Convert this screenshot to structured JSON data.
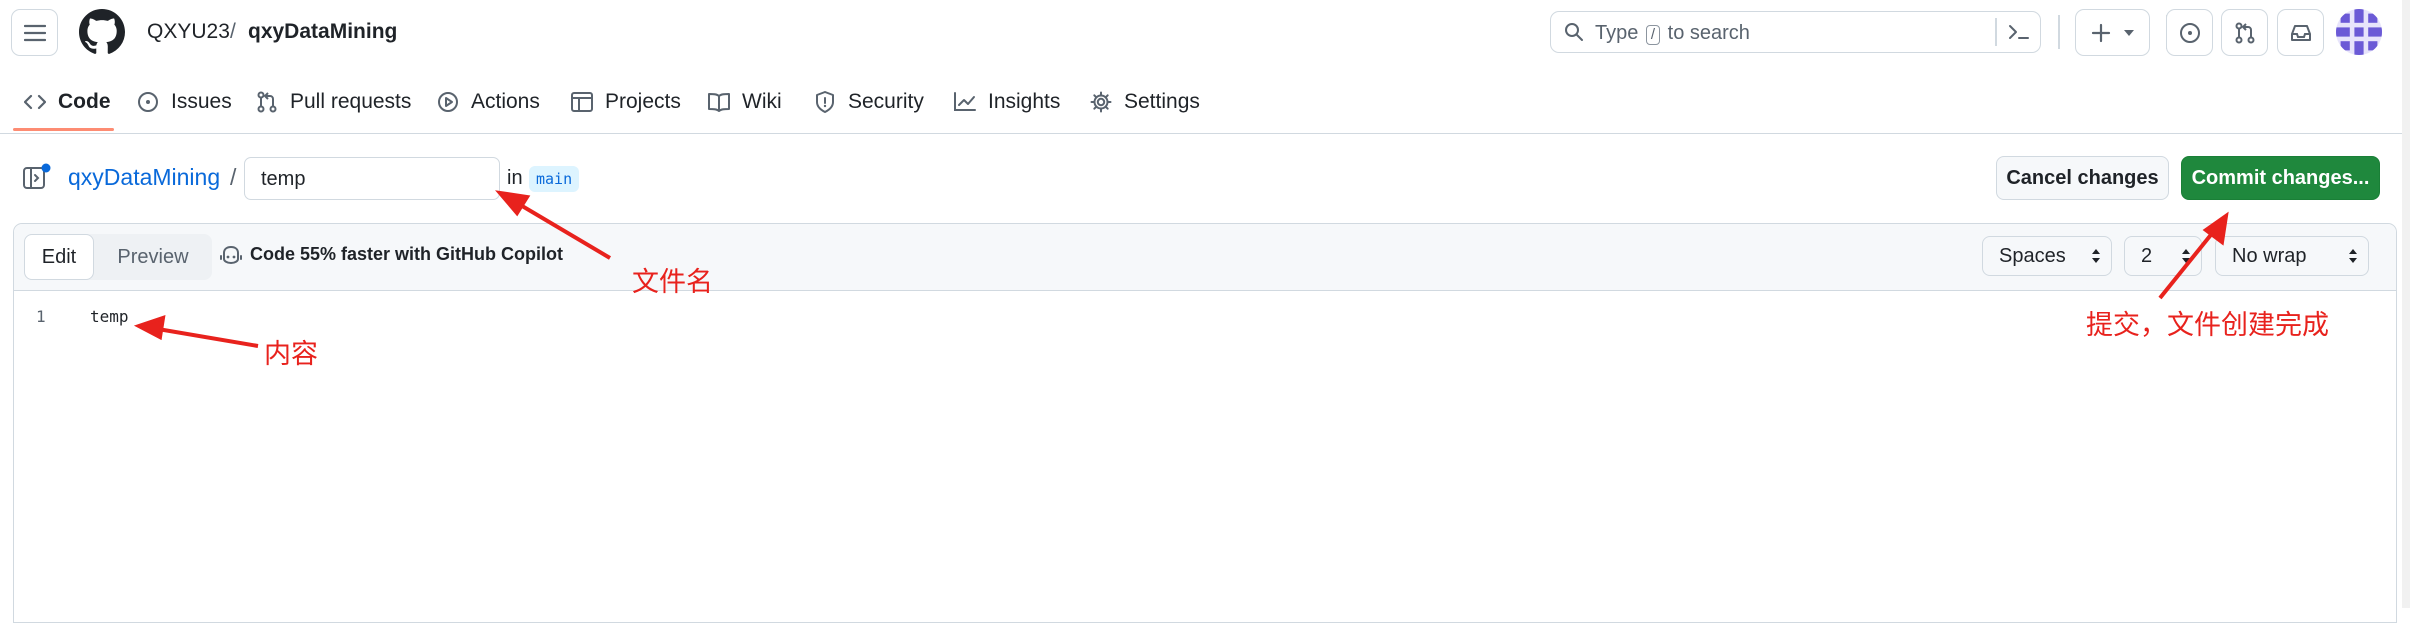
{
  "header": {
    "owner": "QXYU23",
    "separator": "/",
    "repo": "qxyDataMining",
    "search": {
      "prefix": "Type",
      "key": "/",
      "suffix": "to search"
    }
  },
  "tabs": [
    {
      "label": "Code",
      "icon": "code-icon",
      "active": true
    },
    {
      "label": "Issues",
      "icon": "issue-opened-icon"
    },
    {
      "label": "Pull requests",
      "icon": "git-pull-request-icon"
    },
    {
      "label": "Actions",
      "icon": "play-icon"
    },
    {
      "label": "Projects",
      "icon": "table-icon"
    },
    {
      "label": "Wiki",
      "icon": "book-icon"
    },
    {
      "label": "Security",
      "icon": "shield-icon"
    },
    {
      "label": "Insights",
      "icon": "graph-icon"
    },
    {
      "label": "Settings",
      "icon": "gear-icon"
    }
  ],
  "editor_header": {
    "repo_link": "qxyDataMining",
    "separator": "/",
    "filename": "temp",
    "in_label": "in",
    "branch": "main",
    "cancel_label": "Cancel changes",
    "commit_label": "Commit changes..."
  },
  "editor": {
    "edit_tab": "Edit",
    "preview_tab": "Preview",
    "copilot_text": "Code 55% faster with GitHub Copilot",
    "indent_mode": "Spaces",
    "indent_size": "2",
    "wrap_mode": "No wrap",
    "lines": [
      {
        "number": "1",
        "text": "temp"
      }
    ]
  },
  "annotations": {
    "filename_note": "文件名",
    "content_note": "内容",
    "commit_note": "提交，文件创建完成",
    "color": "#e8221d"
  },
  "colors": {
    "accent_link": "#0969da",
    "commit_green": "#1f883d",
    "tab_underline": "#fd8c73"
  }
}
